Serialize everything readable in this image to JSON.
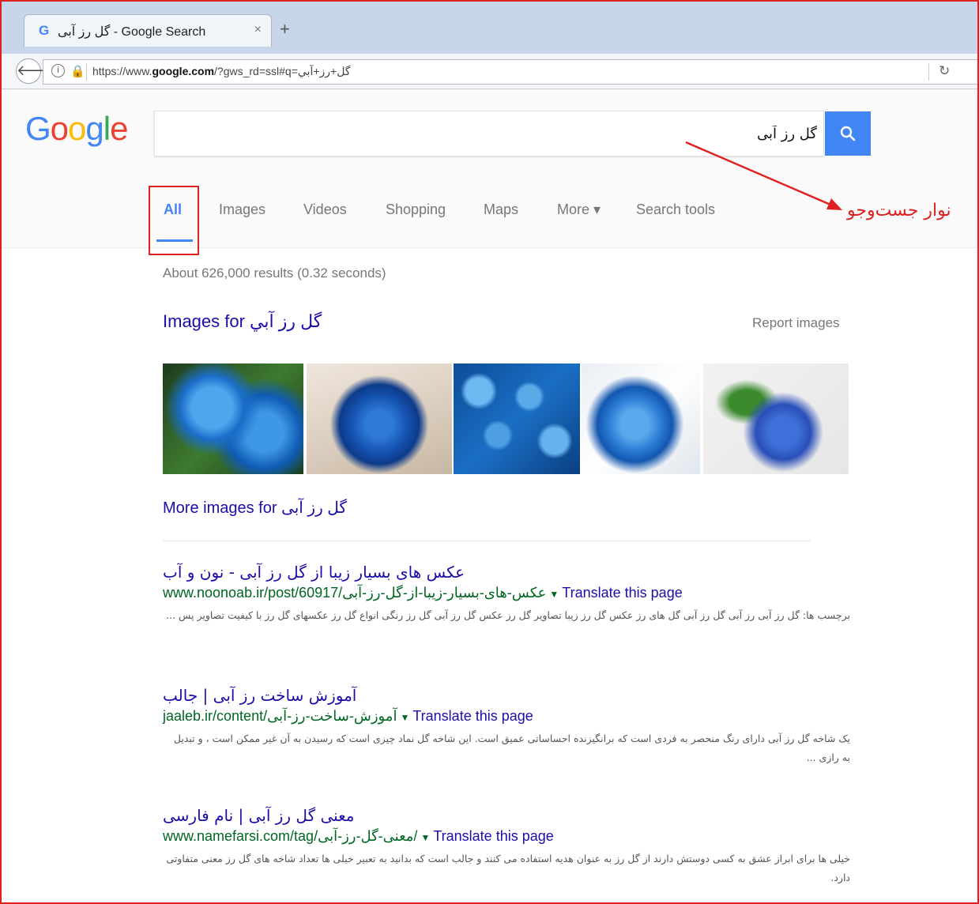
{
  "browser": {
    "tab_title": "گل رز آبی - Google Search",
    "tab_icon": "google-g-icon",
    "tab_close": "×",
    "new_tab": "+",
    "url": "https://www.google.com/?gws_rd=ssl#q=گل+رز+آبي",
    "url_prefix": "https://www.",
    "url_domain": "google.com",
    "url_suffix": "/?gws_rd=ssl#q=گل+رز+آبي"
  },
  "google": {
    "logo_letters": [
      "G",
      "o",
      "o",
      "g",
      "l",
      "e"
    ],
    "search_value": "گل رز آبی",
    "tabs": [
      {
        "label": "All",
        "active": true
      },
      {
        "label": "Images"
      },
      {
        "label": "Videos"
      },
      {
        "label": "Shopping"
      },
      {
        "label": "Maps"
      },
      {
        "label": "More ▾"
      },
      {
        "label": "Search tools"
      }
    ],
    "stats": "About 626,000 results (0.32 seconds)",
    "images_heading": "Images for گل رز آبي",
    "report_images": "Report images",
    "more_images": "More images for گل رز آبی"
  },
  "annotation": {
    "label": "نوار جست‌وجو",
    "color": "#e02020"
  },
  "results": [
    {
      "title": "عکس های بسیار زیبا از گل رز آبی - نون و آب",
      "url": "www.noonoab.ir/post/60917/عکس-های-بسیار-زیبا-از-گل-رز-آبی",
      "translate": "Translate this page",
      "snippet": "برچسب ها: گل رز آبی رز آبی گل رز آبی گل های رز عکس گل رز زیبا تصاویر گل رز عکس گل رز آبی گل رز رنگی انواع گل رز عکسهای گل رز با کیفیت تصاویر پس ..."
    },
    {
      "title": "آموزش ساخت رز آبی | جالب",
      "url": "jaaleb.ir/content/آموزش-ساخت-رز-آبی",
      "translate": "Translate this page",
      "snippet": "یک شاخه گل رز آبی دارای رنگ منحصر به فردی است که برانگیزنده احساساتی عمیق است. این شاخه گل نماد چیزی است که رسیدن به آن غیر ممکن است ، و تبدیل به رازی ..."
    },
    {
      "title": "معنی گل رز آبی | نام فارسی",
      "url": "www.namefarsi.com/tag/معنی-گل-رز-آبی/",
      "translate": "Translate this page",
      "snippet": "خیلی ها برای ابراز عشق به کسی دوستش دارند از گل رز به عنوان هدیه استفاده می کنند و جالب است که بدانید به تعبیر خیلی ها تعداد شاخه های گل رز معنی متفاوتی دارد."
    }
  ],
  "colors": {
    "link": "#1a0dab",
    "url_green": "#006621",
    "google_blue": "#4285f4",
    "highlight_red": "#e02020"
  }
}
